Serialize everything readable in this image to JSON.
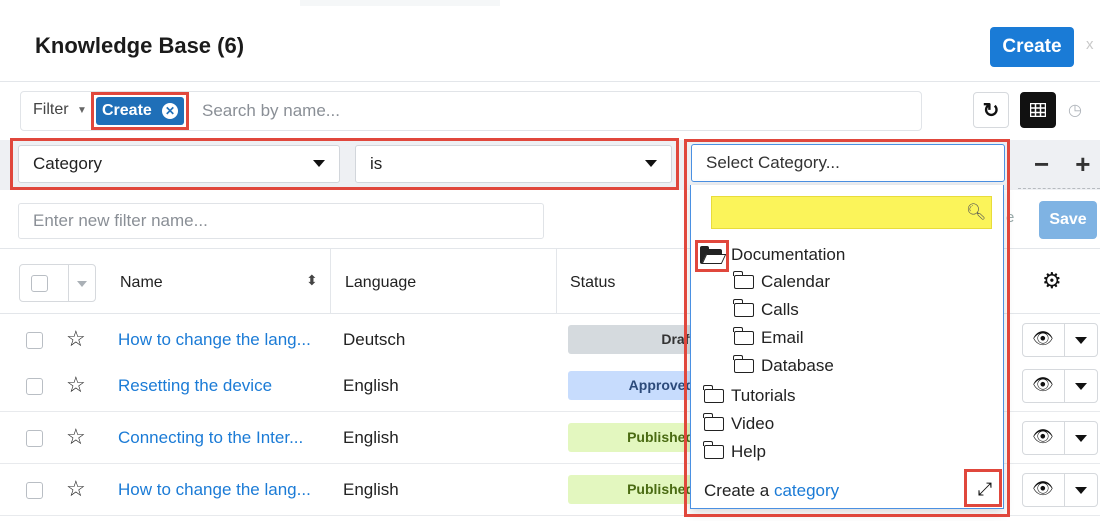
{
  "header": {
    "title": "Knowledge Base (6)",
    "create_label": "Create",
    "close_glyph": "x"
  },
  "filter": {
    "label": "Filter",
    "pill_label": "Create",
    "search_placeholder": "Search by name...",
    "field_value": "Category",
    "operator_value": "is",
    "category_placeholder": "Select Category...",
    "name_placeholder": "Enter new filter name...",
    "save_label": "Save"
  },
  "table": {
    "columns": [
      "Name",
      "Language",
      "Status"
    ],
    "rows": [
      {
        "name": "How to change the lang...",
        "language": "Deutsch",
        "status": "Draft",
        "status_key": "draft"
      },
      {
        "name": "Resetting the device",
        "language": "English",
        "status": "Approved",
        "status_key": "approved"
      },
      {
        "name": "Connecting to the Inter...",
        "language": "English",
        "status": "Published",
        "status_key": "published"
      },
      {
        "name": "How to change the lang...",
        "language": "English",
        "status": "Published",
        "status_key": "published"
      }
    ]
  },
  "category_dropdown": {
    "tree": [
      {
        "label": "Documentation",
        "level": 0,
        "open": true
      },
      {
        "label": "Calendar",
        "level": 1
      },
      {
        "label": "Calls",
        "level": 1
      },
      {
        "label": "Email",
        "level": 1
      },
      {
        "label": "Database",
        "level": 1
      },
      {
        "label": "Tutorials",
        "level": 0
      },
      {
        "label": "Video",
        "level": 0
      },
      {
        "label": "Help",
        "level": 0
      }
    ],
    "footer_text": "Create a",
    "footer_link": "category"
  },
  "colors": {
    "primary": "#1a7bd6",
    "highlight": "#e0473c",
    "search_highlight": "#fbf45a",
    "draft": "#d5dade",
    "approved": "#c7dcfd",
    "published": "#e3f7bf"
  },
  "icons": [
    "close-icon",
    "filter-caret-icon",
    "pill-remove-icon",
    "refresh-icon",
    "list-view-icon",
    "activity-stream-icon",
    "dropdown-caret-icon",
    "minus-icon",
    "plus-icon",
    "sort-icon",
    "gear-icon",
    "star-icon",
    "eye-icon",
    "search-icon",
    "folder-open-icon",
    "folder-icon",
    "expand-icon"
  ]
}
